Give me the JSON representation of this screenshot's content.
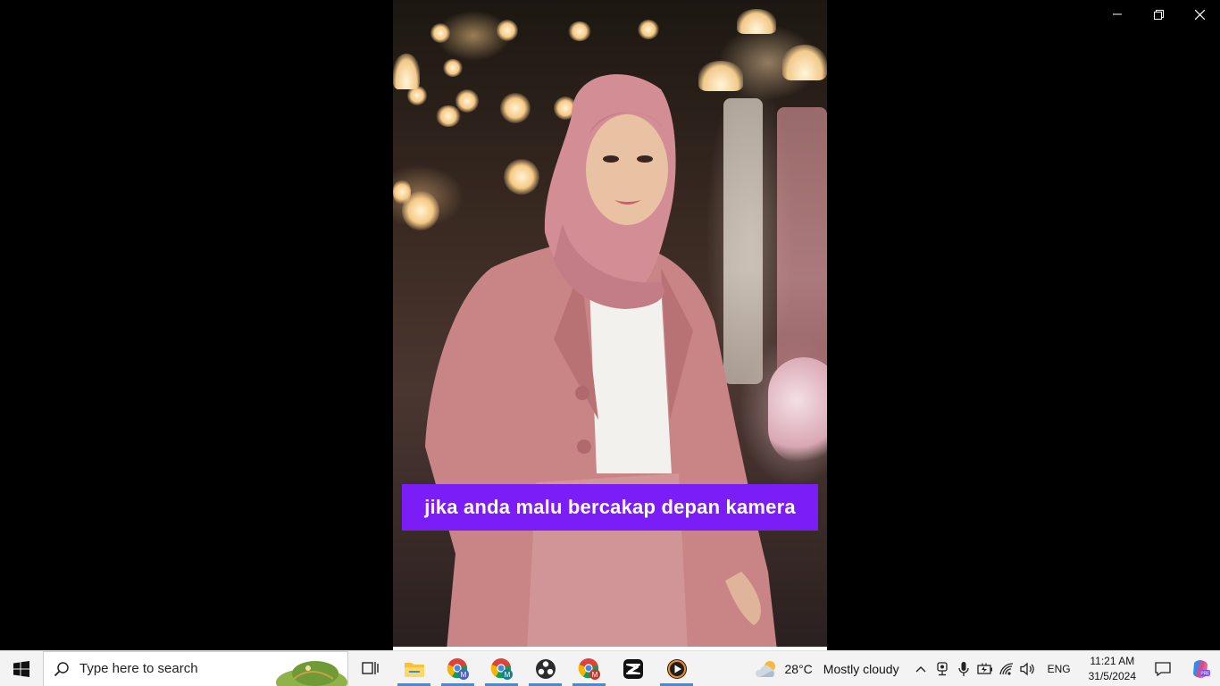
{
  "window": {
    "controls": [
      "minimize",
      "restore",
      "close"
    ]
  },
  "video": {
    "caption": "jika anda malu bercakap depan kamera",
    "caption_bg": "#7b1df6"
  },
  "taskbar": {
    "search_placeholder": "Type here to search",
    "apps": [
      {
        "name": "task-view-icon",
        "active": false
      },
      {
        "name": "file-explorer-icon",
        "active": true
      },
      {
        "name": "chrome-profile-m-icon",
        "active": true
      },
      {
        "name": "chrome-profile-m-icon",
        "active": true
      },
      {
        "name": "obs-studio-icon",
        "active": true
      },
      {
        "name": "chrome-profile-m-icon",
        "active": true
      },
      {
        "name": "capcut-icon",
        "active": false
      },
      {
        "name": "media-player-icon",
        "active": true
      }
    ],
    "weather": {
      "temp": "28°C",
      "condition": "Mostly cloudy"
    },
    "language": "ENG",
    "time": "11:21 AM",
    "date": "31/5/2024",
    "accent": "#3a8ee6"
  }
}
